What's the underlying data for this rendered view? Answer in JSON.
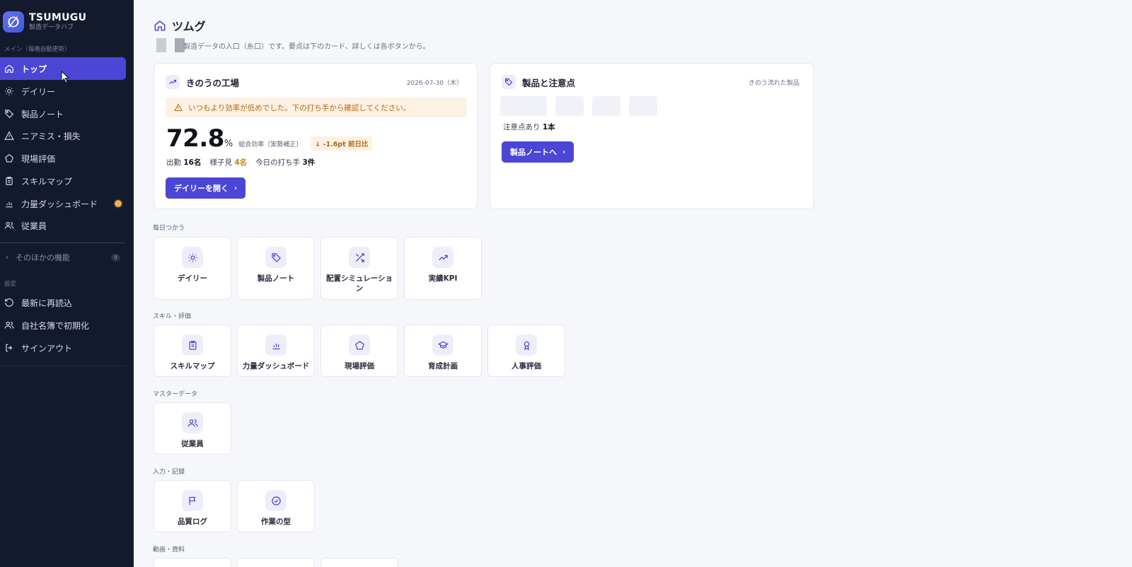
{
  "brand": {
    "name": "TSUMUGU",
    "subtitle": "製造データハブ"
  },
  "sidebar": {
    "main_section_label": "メイン（毎晩自動更新）",
    "items": [
      {
        "label": "トップ",
        "icon": "home-icon",
        "active": true
      },
      {
        "label": "デイリー",
        "icon": "sun-icon"
      },
      {
        "label": "製品ノート",
        "icon": "tag-icon"
      },
      {
        "label": "ニアミス・損失",
        "icon": "warning-icon"
      },
      {
        "label": "現場評価",
        "icon": "pentagon-icon"
      },
      {
        "label": "スキルマップ",
        "icon": "clipboard-icon"
      },
      {
        "label": "力量ダッシュボード",
        "icon": "bar-chart-icon",
        "badge_color": "#f3b13b"
      },
      {
        "label": "従業員",
        "icon": "users-icon"
      }
    ],
    "more": {
      "label": "そのほかの機能",
      "count": "9"
    },
    "settings_section_label": "設定",
    "settings_items": [
      {
        "label": "最新に再読込",
        "icon": "refresh-icon"
      },
      {
        "label": "自社名簿で初期化",
        "icon": "users-icon"
      },
      {
        "label": "サインアウト",
        "icon": "sign-out-icon"
      }
    ]
  },
  "page": {
    "title": "ツムグ",
    "intro": "製造データの入口（糸口）です。要点は下のカード、詳しくは各ボタンから。"
  },
  "factory_card": {
    "title": "きのうの工場",
    "date": "2026-07-30（木）",
    "alert": "いつもより効率が低めでした。下の打ち手から確認してください。",
    "kpi_value": "72.8",
    "kpi_unit": "%",
    "kpi_label": "総合効率（実勢補正）",
    "kpi_delta": "↓ -1.6pt 前日比",
    "stats": {
      "attendance_label": "出勤",
      "attendance_value": "16名",
      "watch_label": "様子見",
      "watch_value": "4名",
      "actions_label": "今日の打ち手",
      "actions_value": "3件"
    },
    "button": "デイリーを開く"
  },
  "products_card": {
    "title": "製品と注意点",
    "meta": "きのう流れた製品",
    "note_label": "注意点あり",
    "note_value": "1本",
    "button": "製品ノートへ"
  },
  "groups": [
    {
      "label": "毎日つかう",
      "tiles": [
        {
          "label": "デイリー",
          "icon": "sun-icon"
        },
        {
          "label": "製品ノート",
          "icon": "tag-icon"
        },
        {
          "label": "配置シミュレーション",
          "icon": "shuffle-icon"
        },
        {
          "label": "実績KPI",
          "icon": "trending-up-icon"
        }
      ]
    },
    {
      "label": "スキル・評価",
      "tiles": [
        {
          "label": "スキルマップ",
          "icon": "clipboard-icon"
        },
        {
          "label": "力量ダッシュボード",
          "icon": "bar-chart-icon"
        },
        {
          "label": "現場評価",
          "icon": "pentagon-icon"
        },
        {
          "label": "育成計画",
          "icon": "graduation-cap-icon"
        },
        {
          "label": "人事評価",
          "icon": "award-icon"
        }
      ]
    },
    {
      "label": "マスターデータ",
      "tiles": [
        {
          "label": "従業員",
          "icon": "users-icon"
        }
      ]
    },
    {
      "label": "入力・記録",
      "tiles": [
        {
          "label": "品質ログ",
          "icon": "flag-icon"
        },
        {
          "label": "作業の型",
          "icon": "check-circle-icon"
        }
      ]
    },
    {
      "label": "動画・資料",
      "tiles": []
    }
  ],
  "colors": {
    "accent": "#4b46d6",
    "sidebar_bg": "#141a2e",
    "warn": "#b26a12"
  }
}
